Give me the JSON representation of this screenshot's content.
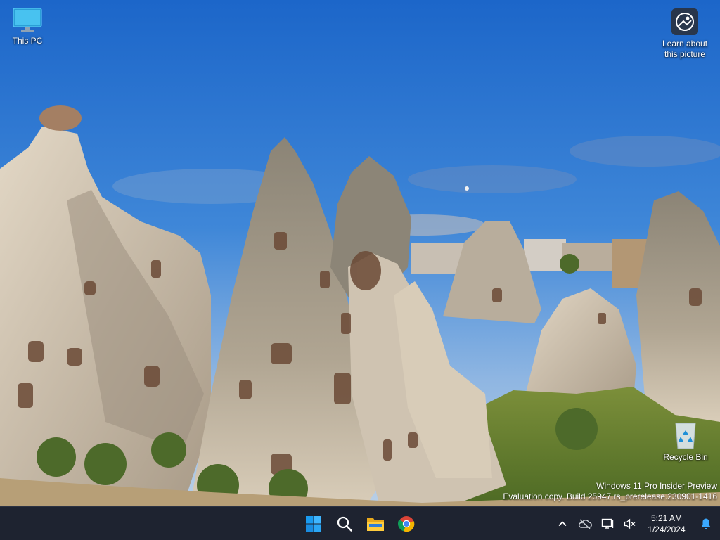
{
  "desktop": {
    "icons": [
      {
        "label": "This PC",
        "icon": "this-pc-icon"
      },
      {
        "label": "Learn about this picture",
        "icon": "learn-about-picture-icon"
      },
      {
        "label": "Recycle Bin",
        "icon": "recycle-bin-icon"
      }
    ],
    "watermark": {
      "line1": "Windows 11 Pro Insider Preview",
      "line2": "Evaluation copy. Build 25947.rs_prerelease.230901-1416"
    }
  },
  "taskbar": {
    "apps": [
      {
        "name": "Start",
        "icon": "windows-start-icon"
      },
      {
        "name": "Search",
        "icon": "search-icon"
      },
      {
        "name": "File Explorer",
        "icon": "file-explorer-icon"
      },
      {
        "name": "Google Chrome",
        "icon": "chrome-icon"
      }
    ],
    "tray": {
      "icons": [
        "chevron-up-icon",
        "onedrive-icon",
        "network-icon",
        "volume-muted-icon"
      ],
      "time": "5:21 AM",
      "date": "1/24/2024"
    }
  },
  "colors": {
    "taskbar_bg": "#1e2330",
    "accent": "#1a9bf0",
    "sky_top": "#1f6fd0",
    "rock": "#cfc2b0"
  }
}
